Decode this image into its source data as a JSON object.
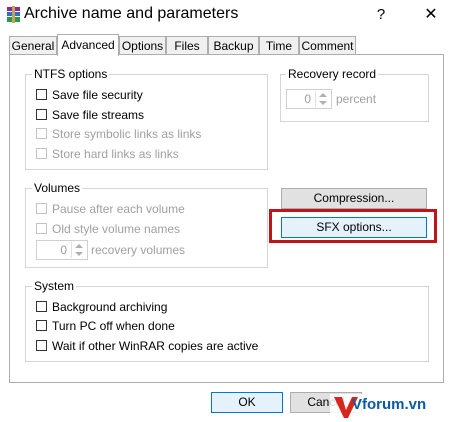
{
  "window": {
    "title": "Archive name and parameters",
    "help_glyph": "?",
    "close_glyph": "✕"
  },
  "tabs": [
    {
      "label": "General"
    },
    {
      "label": "Advanced"
    },
    {
      "label": "Options"
    },
    {
      "label": "Files"
    },
    {
      "label": "Backup"
    },
    {
      "label": "Time"
    },
    {
      "label": "Comment"
    }
  ],
  "ntfs": {
    "legend": "NTFS options",
    "items": [
      {
        "label": "Save file security",
        "checked": false,
        "enabled": true
      },
      {
        "label": "Save file streams",
        "checked": false,
        "enabled": true
      },
      {
        "label": "Store symbolic links as links",
        "checked": false,
        "enabled": false
      },
      {
        "label": "Store hard links as links",
        "checked": false,
        "enabled": false
      }
    ]
  },
  "recovery": {
    "legend": "Recovery record",
    "value": "0",
    "unit": "percent"
  },
  "volumes": {
    "legend": "Volumes",
    "items": [
      {
        "label": "Pause after each volume",
        "checked": false,
        "enabled": false
      },
      {
        "label": "Old style volume names",
        "checked": false,
        "enabled": false
      }
    ],
    "recovery_value": "0",
    "recovery_label": "recovery volumes"
  },
  "side_buttons": {
    "compression": "Compression...",
    "sfx": "SFX options..."
  },
  "system": {
    "legend": "System",
    "items": [
      {
        "label": "Background archiving",
        "checked": false
      },
      {
        "label": "Turn PC off when done",
        "checked": false
      },
      {
        "label": "Wait if other WinRAR copies are active",
        "checked": false
      }
    ]
  },
  "footer": {
    "ok": "OK",
    "cancel": "Cancel"
  },
  "watermark": {
    "text": "Vforum.vn"
  },
  "colors": {
    "highlight": "#c0141c",
    "focus_border": "#0078d7",
    "watermark": "#0c5aa6"
  }
}
